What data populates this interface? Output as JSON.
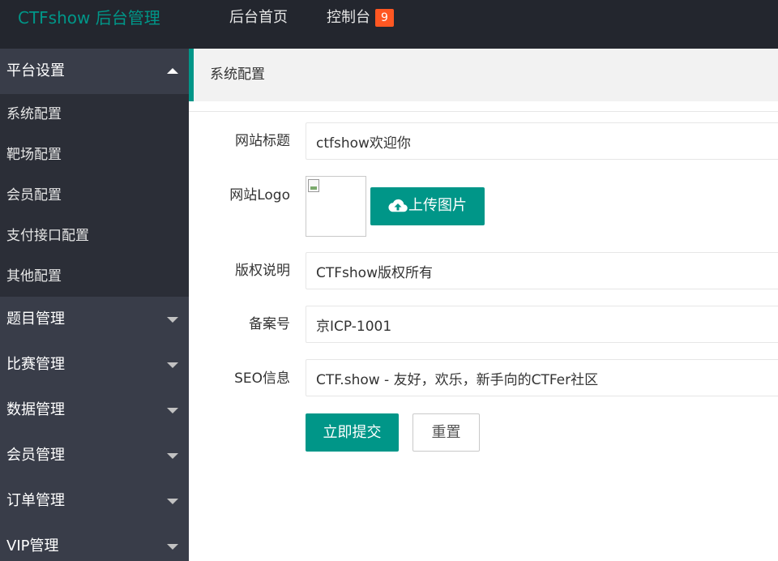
{
  "header": {
    "brand": "CTFshow 后台管理",
    "nav": [
      {
        "label": "后台首页"
      },
      {
        "label": "控制台",
        "badge": "9"
      }
    ]
  },
  "sidebar": {
    "groups": [
      {
        "label": "平台设置",
        "expanded": true,
        "items": [
          "系统配置",
          "靶场配置",
          "会员配置",
          "支付接口配置",
          "其他配置"
        ]
      },
      {
        "label": "题目管理",
        "expanded": false
      },
      {
        "label": "比赛管理",
        "expanded": false
      },
      {
        "label": "数据管理",
        "expanded": false
      },
      {
        "label": "会员管理",
        "expanded": false
      },
      {
        "label": "订单管理",
        "expanded": false
      },
      {
        "label": "VIP管理",
        "expanded": false
      }
    ]
  },
  "main": {
    "tab_title": "系统配置",
    "form": {
      "site_title": {
        "label": "网站标题",
        "value": "ctfshow欢迎你"
      },
      "site_logo": {
        "label": "网站Logo",
        "upload_label": "上传图片"
      },
      "copyright": {
        "label": "版权说明",
        "value": "CTFshow版权所有"
      },
      "icp": {
        "label": "备案号",
        "value": "京ICP-1001"
      },
      "seo": {
        "label": "SEO信息",
        "value": "CTF.show - 友好，欢乐，新手向的CTFer社区"
      }
    },
    "buttons": {
      "submit": "立即提交",
      "reset": "重置"
    }
  },
  "colors": {
    "accent": "#009688",
    "topbar_bg": "#23262e",
    "sidebar_bg": "#393d49",
    "submenu_bg": "#2b2e37",
    "badge_bg": "#ff5722"
  }
}
